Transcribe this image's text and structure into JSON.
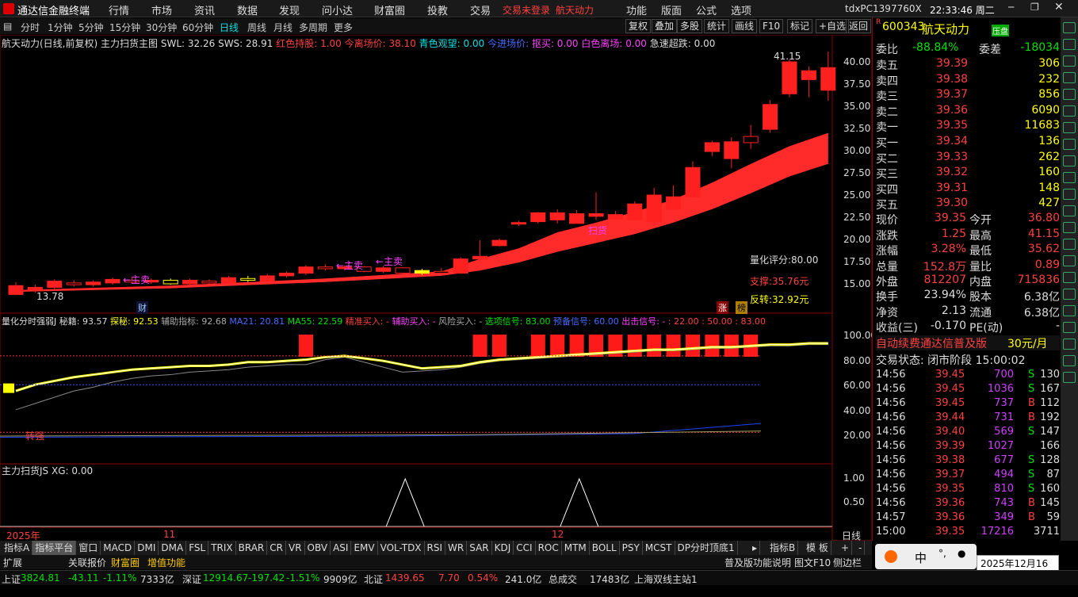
{
  "app": {
    "title": "通达信金融终端",
    "login": "交易未登录",
    "stock_tag": "航天动力",
    "pc": "tdxPC1397760X",
    "clock": "22:33:46 周二"
  },
  "menu": [
    "行情",
    "市场",
    "资讯",
    "数据",
    "发现",
    "问小达",
    "财富圈",
    "投教",
    "交易"
  ],
  "menu_right": [
    "功能",
    "版面",
    "公式",
    "选项"
  ],
  "periods": [
    "分时",
    "1分钟",
    "5分钟",
    "15分钟",
    "30分钟",
    "60分钟",
    "日线",
    "周线",
    "月线",
    "多周期",
    "更多"
  ],
  "tools": [
    "复权",
    "叠加",
    "多股",
    "统计",
    "画线",
    "F10",
    "标记",
    "+自选",
    "返回"
  ],
  "main_legend": {
    "name": "航天动力(日线,前复权)",
    "ind": "主力扫货主图",
    "swl": "SWL: 32.26",
    "sws": "SWS: 28.91",
    "hc": "红色持股: 1.00",
    "jl": "今离场价: 38.10",
    "qs": "青色观望: 0.00",
    "jj": "今进场价:",
    "dc": "抠买: 0.00",
    "bs": "白色离场: 0.00",
    "jz": "急速超跌: 0.00"
  },
  "main_y": [
    "40.00",
    "37.50",
    "35.00",
    "32.50",
    "30.00",
    "27.50",
    "25.00",
    "22.50",
    "20.00",
    "17.50",
    "15.00"
  ],
  "high_label": "41.15",
  "low_label": "13.78",
  "main_notes": {
    "score": "量化评分:80.00",
    "support": "支撑:35.76元",
    "reversal": "反转:32.92元",
    "saohuo": "扫货",
    "zhumai": "←主卖",
    "zhang": "涨",
    "bang": "榜",
    "cai": "财"
  },
  "mid_legend": {
    "name": "量化分时强弱J",
    "mj": "秘籍: 93.57",
    "tm": "探秘: 92.53",
    "fz": "辅助指标: 92.68",
    "ma21": "MA21: 20.81",
    "ma55": "MA55: 22.59",
    "jz": "精准买入: -",
    "fzb": "辅助买入: -",
    "fx": "风险买入: -",
    "xx": "选项信号: 83.00",
    "yb": "预备信号: 60.00",
    "cj": "出击信号: -",
    "tail": ": 22.00 : 50.00 : 83.00"
  },
  "mid_y": [
    "100.00",
    "80.00",
    "60.00",
    "40.00",
    "20.00"
  ],
  "mid_note": "转强",
  "low_legend": {
    "name": "主力扫货JS",
    "xg": "XG: 0.00"
  },
  "low_y": [
    "1.00",
    "0.50"
  ],
  "x_labels": [
    "2025年",
    "11",
    "12"
  ],
  "x_unit": "日线",
  "quote": {
    "code": "600343",
    "name": "航天动力",
    "tag": "R",
    "badge": "压盘",
    "weibi_label": "委比",
    "weibi": "-88.84%",
    "weicha_label": "委差",
    "weicha": "-18034",
    "asks": [
      {
        "l": "卖五",
        "p": "39.39",
        "v": "306"
      },
      {
        "l": "卖四",
        "p": "39.38",
        "v": "232"
      },
      {
        "l": "卖三",
        "p": "39.37",
        "v": "856"
      },
      {
        "l": "卖二",
        "p": "39.36",
        "v": "6090"
      },
      {
        "l": "卖一",
        "p": "39.35",
        "v": "11683"
      }
    ],
    "bids": [
      {
        "l": "买一",
        "p": "39.34",
        "v": "136"
      },
      {
        "l": "买二",
        "p": "39.33",
        "v": "262"
      },
      {
        "l": "买三",
        "p": "39.32",
        "v": "160"
      },
      {
        "l": "买四",
        "p": "39.31",
        "v": "148"
      },
      {
        "l": "买五",
        "p": "39.30",
        "v": "427"
      }
    ],
    "stats": [
      {
        "a": "现价",
        "b": "39.35",
        "c": "今开",
        "d": "36.80"
      },
      {
        "a": "涨跌",
        "b": "1.25",
        "c": "最高",
        "d": "41.15"
      },
      {
        "a": "涨幅",
        "b": "3.28%",
        "c": "最低",
        "d": "35.62"
      },
      {
        "a": "总量",
        "b": "152.8万",
        "c": "量比",
        "d": "0.89"
      },
      {
        "a": "外盘",
        "b": "812207",
        "c": "内盘",
        "d": "715836"
      }
    ],
    "stats2": [
      {
        "a": "换手",
        "b": "23.94%",
        "c": "股本",
        "d": "6.38亿"
      },
      {
        "a": "净资",
        "b": "2.13",
        "c": "流通",
        "d": "6.38亿"
      },
      {
        "a": "收益(三)",
        "b": "-0.170",
        "c": "PE(动)",
        "d": "-"
      }
    ],
    "promo": "自动续费通达信普及版",
    "promo_price": "30元/月",
    "trade_state": "交易状态: 闭市阶段 15:00:02",
    "ticks": [
      {
        "t": "14:56",
        "p": "39.45",
        "v": "700",
        "s": "S",
        "n": "130"
      },
      {
        "t": "14:56",
        "p": "39.45",
        "v": "1036",
        "s": "S",
        "n": "167"
      },
      {
        "t": "14:56",
        "p": "39.45",
        "v": "737",
        "s": "B",
        "n": "112"
      },
      {
        "t": "14:56",
        "p": "39.44",
        "v": "731",
        "s": "B",
        "n": "192"
      },
      {
        "t": "14:56",
        "p": "39.40",
        "v": "569",
        "s": "S",
        "n": "147"
      },
      {
        "t": "14:56",
        "p": "39.39",
        "v": "1027",
        "s": "",
        "n": "166"
      },
      {
        "t": "14:56",
        "p": "39.38",
        "v": "677",
        "s": "S",
        "n": "128"
      },
      {
        "t": "14:56",
        "p": "39.37",
        "v": "494",
        "s": "S",
        "n": "87"
      },
      {
        "t": "14:56",
        "p": "39.35",
        "v": "810",
        "s": "S",
        "n": "160"
      },
      {
        "t": "14:56",
        "p": "39.36",
        "v": "743",
        "s": "B",
        "n": "145"
      },
      {
        "t": "14:57",
        "p": "39.36",
        "v": "349",
        "s": "B",
        "n": "59"
      },
      {
        "t": "15:00",
        "p": "39.35",
        "v": "17216",
        "s": "",
        "n": "3711"
      }
    ]
  },
  "tabs": [
    "指标A",
    "指标平台",
    "窗口",
    "MACD",
    "DMI",
    "DMA",
    "FSL",
    "TRIX",
    "BRAR",
    "CR",
    "VR",
    "OBV",
    "ASI",
    "EMV",
    "VOL-TDX",
    "RSI",
    "WR",
    "SAR",
    "KDJ",
    "CCI",
    "ROC",
    "MTM",
    "BOLL",
    "PSY",
    "MCST",
    "DP分时顶底1"
  ],
  "tabs_right": [
    "指标B",
    "模 板"
  ],
  "tabs2": [
    "扩展",
    "关联报价",
    "财富圈",
    "增值功能"
  ],
  "tabs2_right": [
    "普及版功能说明",
    "图文F10",
    "侧边栏"
  ],
  "status": {
    "sh": "上证",
    "sh_v": "3824.81",
    "sh_c": "-43.11",
    "sh_p": "-1.11%",
    "sh_a": "7333亿",
    "sz": "深证",
    "sz_v": "12914.67",
    "sz_c": "-197.42",
    "sz_p": "-1.51%",
    "sz_a": "9909亿",
    "bz": "北证",
    "bz_v": "1439.65",
    "bz_c": "7.70",
    "bz_p": "0.54%",
    "bz_a": "241.0亿",
    "tot": "总成交",
    "tot_v": "17483亿",
    "srv": "上海双线主站1"
  },
  "ime": {
    "lang": "中",
    "date": "2025年12月16日",
    "weekday": "星期二"
  },
  "candles": [
    [
      13.8,
      14.8,
      13.78,
      15.2
    ],
    [
      14.3,
      14.6,
      14.0,
      14.9
    ],
    [
      14.6,
      15.3,
      14.4,
      15.5
    ],
    [
      15.1,
      14.9,
      14.7,
      15.4
    ],
    [
      14.9,
      15.2,
      14.7,
      15.4
    ],
    [
      15.1,
      15.5,
      14.9,
      15.7
    ],
    [
      15.4,
      15.2,
      15.0,
      15.8
    ],
    [
      15.2,
      15.4,
      15.0,
      15.6
    ],
    [
      15.4,
      15.0,
      14.9,
      15.6
    ],
    [
      15.0,
      15.4,
      14.9,
      15.6
    ],
    [
      15.3,
      15.1,
      14.9,
      15.5
    ],
    [
      15.1,
      15.7,
      15.0,
      15.9
    ],
    [
      15.6,
      15.4,
      15.2,
      15.9
    ],
    [
      15.3,
      15.9,
      15.1,
      16.1
    ],
    [
      15.9,
      16.2,
      15.7,
      16.4
    ],
    [
      16.2,
      16.9,
      16.0,
      17.1
    ],
    [
      16.9,
      16.7,
      16.5,
      17.2
    ],
    [
      16.7,
      16.9,
      16.5,
      17.1
    ],
    [
      16.9,
      16.4,
      16.3,
      17.0
    ],
    [
      16.4,
      16.8,
      16.2,
      17.0
    ],
    [
      16.8,
      16.2,
      16.1,
      16.9
    ],
    [
      16.2,
      16.5,
      16.0,
      16.7
    ],
    [
      16.4,
      16.2,
      16.1,
      16.8
    ],
    [
      16.2,
      17.8,
      16.2,
      18.0
    ],
    [
      17.8,
      18.1,
      17.6,
      19.9
    ],
    [
      19.3,
      19.9,
      19.2,
      20.1
    ],
    [
      21.9,
      21.9,
      21.5,
      22.1
    ],
    [
      22.0,
      23.0,
      21.8,
      23.1
    ],
    [
      22.2,
      23.0,
      21.8,
      23.4
    ],
    [
      21.8,
      22.9,
      21.8,
      23.3
    ],
    [
      22.6,
      22.9,
      22.2,
      25.3
    ],
    [
      22.3,
      22.8,
      22.2,
      23.2
    ],
    [
      22.2,
      24.0,
      22.2,
      24.3
    ],
    [
      22.0,
      25.0,
      21.7,
      25.8
    ],
    [
      23.4,
      24.8,
      23.3,
      26.1
    ],
    [
      24.8,
      28.1,
      24.8,
      28.8
    ],
    [
      29.9,
      30.9,
      29.4,
      31.1
    ],
    [
      29.1,
      31.0,
      28.0,
      31.5
    ],
    [
      31.6,
      30.9,
      30.2,
      32.9
    ],
    [
      32.4,
      35.2,
      32.0,
      35.7
    ],
    [
      36.4,
      40.0,
      36.0,
      40.3
    ],
    [
      38.0,
      39.0,
      36.0,
      39.5
    ],
    [
      36.8,
      39.35,
      35.62,
      41.15
    ]
  ],
  "yellow_idx": [
    8,
    12,
    21
  ],
  "band": [
    [
      0,
      14.3,
      14.1
    ],
    [
      8,
      14.8,
      14.5
    ],
    [
      16,
      15.6,
      15.2
    ],
    [
      22,
      16.4,
      15.9
    ],
    [
      24,
      17.8,
      16.5
    ],
    [
      26,
      19.0,
      17.4
    ],
    [
      28,
      20.8,
      18.6
    ],
    [
      30,
      21.9,
      19.6
    ],
    [
      32,
      23.1,
      20.6
    ],
    [
      34,
      24.5,
      21.9
    ],
    [
      36,
      26.4,
      23.4
    ],
    [
      38,
      28.5,
      25.2
    ],
    [
      40,
      30.5,
      27.1
    ],
    [
      42,
      32.0,
      28.5
    ]
  ],
  "mid_bars": [
    [
      15,
      28
    ],
    [
      24,
      28
    ],
    [
      25,
      28
    ],
    [
      27,
      28
    ],
    [
      28,
      28
    ],
    [
      29,
      28
    ],
    [
      30,
      28
    ],
    [
      31,
      28
    ],
    [
      32,
      28
    ],
    [
      33,
      28
    ],
    [
      34,
      28
    ],
    [
      35,
      28
    ],
    [
      36,
      28
    ],
    [
      37,
      28
    ],
    [
      38,
      28
    ]
  ],
  "mid_line": [
    55,
    60,
    63,
    66,
    68,
    70,
    72,
    73,
    74,
    75,
    75,
    76,
    78,
    78,
    79,
    80,
    82,
    83,
    81,
    79,
    76,
    73,
    74,
    75,
    78,
    80,
    81,
    82,
    83,
    84,
    85,
    86,
    87,
    88,
    88,
    89,
    90,
    90,
    91,
    92,
    92,
    93,
    93
  ],
  "mid_line2": [
    40,
    45,
    50,
    55,
    58,
    62,
    65,
    67,
    68,
    70,
    71,
    72,
    74,
    75,
    76,
    76,
    80,
    82,
    78,
    74,
    70,
    71,
    72,
    74,
    77,
    79,
    80,
    81,
    82,
    83,
    84,
    85,
    86,
    87,
    87,
    88,
    89,
    89,
    90,
    91,
    91,
    92,
    92
  ],
  "peaks": [
    20.5,
    29.5
  ]
}
